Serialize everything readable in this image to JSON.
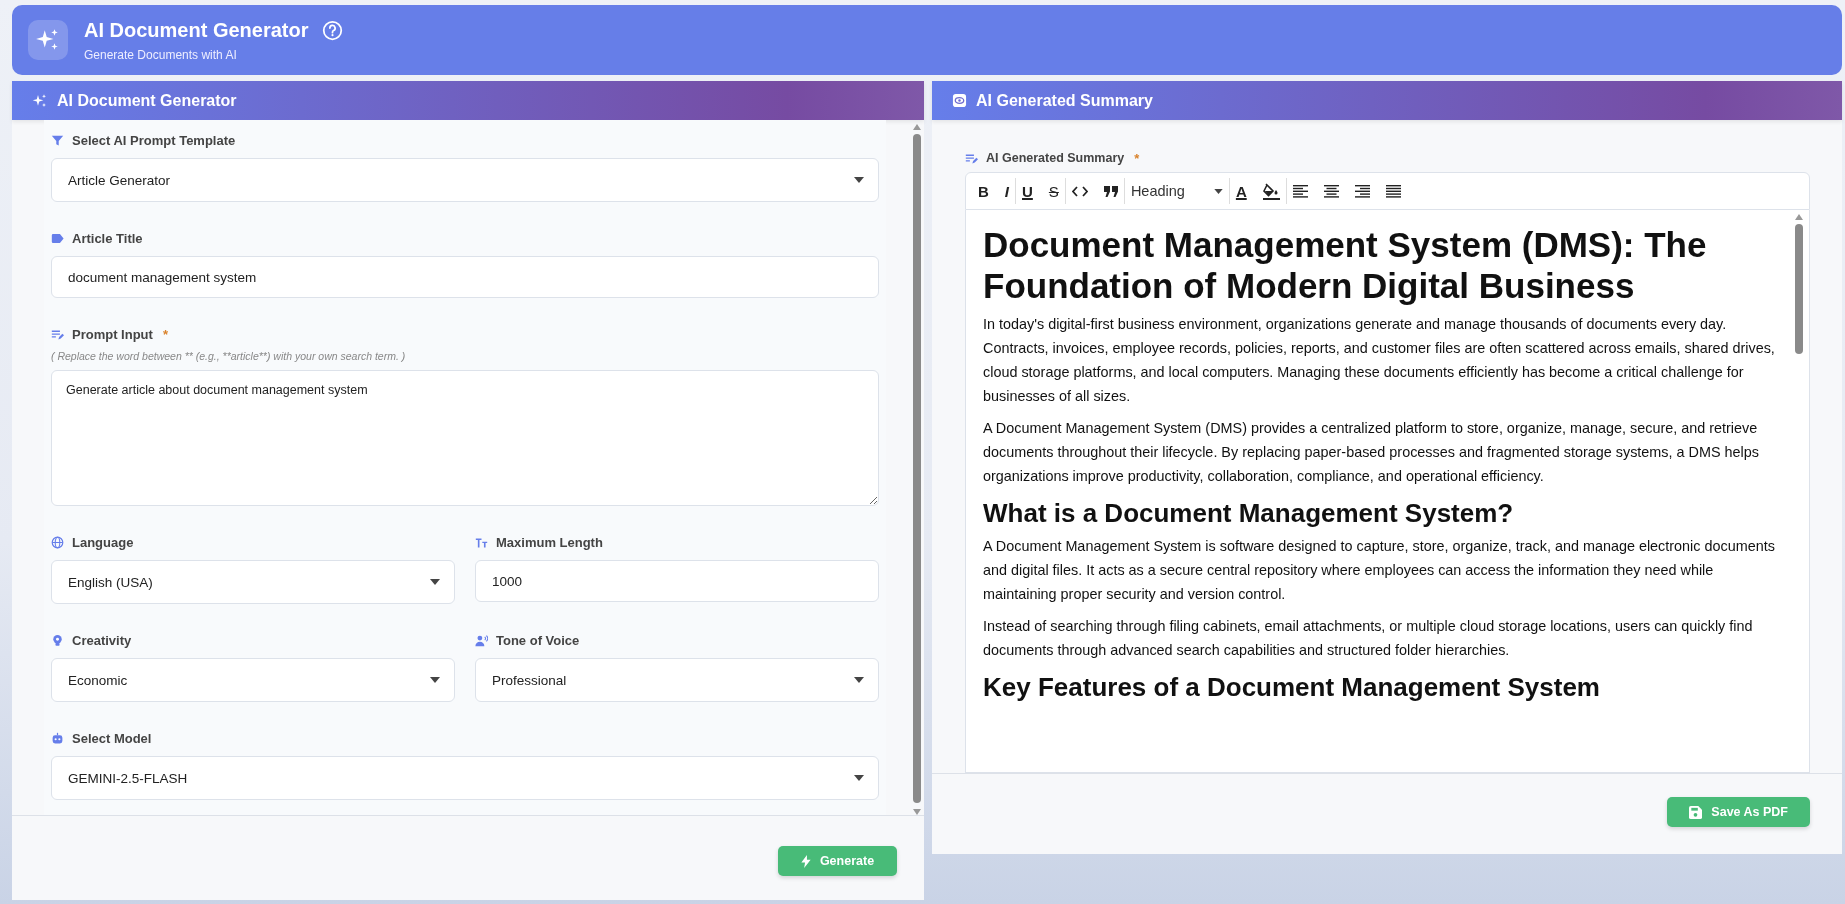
{
  "header": {
    "title": "AI Document Generator",
    "subtitle": "Generate Documents with AI"
  },
  "generator_panel": {
    "title": "AI Document Generator",
    "rows": [
      [
        {
          "kind": "select",
          "label": "Select AI Prompt Template",
          "value": "Article Generator"
        }
      ],
      [
        {
          "kind": "text",
          "label": "Article Title",
          "value": "document management system"
        }
      ],
      [
        {
          "kind": "textarea",
          "label": "Prompt Input",
          "required_mark": "*",
          "hint": "( Replace the word between ** (e.g., **article**) with your own search term. )",
          "value": "Generate article about document management system"
        }
      ],
      [
        {
          "kind": "select",
          "label": "Language",
          "value": "English (USA)"
        },
        {
          "kind": "text",
          "label": "Maximum Length",
          "value": "1000"
        }
      ],
      [
        {
          "kind": "select",
          "label": "Creativity",
          "value": "Economic"
        },
        {
          "kind": "select",
          "label": "Tone of Voice",
          "value": "Professional"
        }
      ],
      [
        {
          "kind": "select",
          "label": "Select Model",
          "value": "GEMINI-2.5-FLASH"
        }
      ]
    ],
    "button": "Generate"
  },
  "summary_panel": {
    "title": "AI Generated Summary",
    "editor_label": "AI Generated Summary",
    "required_mark": "*",
    "toolbar": [
      [
        {
          "kind": "bold",
          "glyph": "B"
        },
        {
          "kind": "italic",
          "glyph": "I"
        }
      ],
      [
        {
          "kind": "underline",
          "glyph": "U"
        },
        {
          "kind": "strike",
          "glyph": "S"
        }
      ],
      [
        {
          "kind": "code"
        },
        {
          "kind": "quote"
        }
      ],
      [
        {
          "kind": "heading",
          "value": "Heading"
        }
      ],
      [
        {
          "kind": "text-color",
          "glyph": "A"
        },
        {
          "kind": "fill-color"
        }
      ],
      [
        {
          "kind": "align-left"
        },
        {
          "kind": "align-center"
        },
        {
          "kind": "align-right"
        },
        {
          "kind": "justify"
        }
      ]
    ],
    "document": [
      {
        "kind": "h1",
        "text": "Document Management System (DMS): The Foundation of Modern Digital Business"
      },
      {
        "kind": "p",
        "text": "In today's digital-first business environment, organizations generate and manage thousands of documents every day. Contracts, invoices, employee records, policies, reports, and customer files are often scattered across emails, shared drives, cloud storage platforms, and local computers. Managing these documents efficiently has become a critical challenge for businesses of all sizes."
      },
      {
        "kind": "p",
        "text": "A Document Management System (DMS) provides a centralized platform to store, organize, manage, secure, and retrieve documents throughout their lifecycle. By replacing paper-based processes and fragmented storage systems, a DMS helps organizations improve productivity, collaboration, compliance, and operational efficiency."
      },
      {
        "kind": "h2",
        "text": "What is a Document Management System?"
      },
      {
        "kind": "p",
        "text": "A Document Management System is software designed to capture, store, organize, track, and manage electronic documents and digital files. It acts as a secure central repository where employees can access the information they need while maintaining proper security and version control."
      },
      {
        "kind": "p",
        "text": "Instead of searching through filing cabinets, email attachments, or multiple cloud storage locations, users can quickly find documents through advanced search capabilities and structured folder hierarchies."
      },
      {
        "kind": "h2",
        "text": "Key Features of a Document Management System"
      }
    ],
    "button": "Save As PDF"
  }
}
